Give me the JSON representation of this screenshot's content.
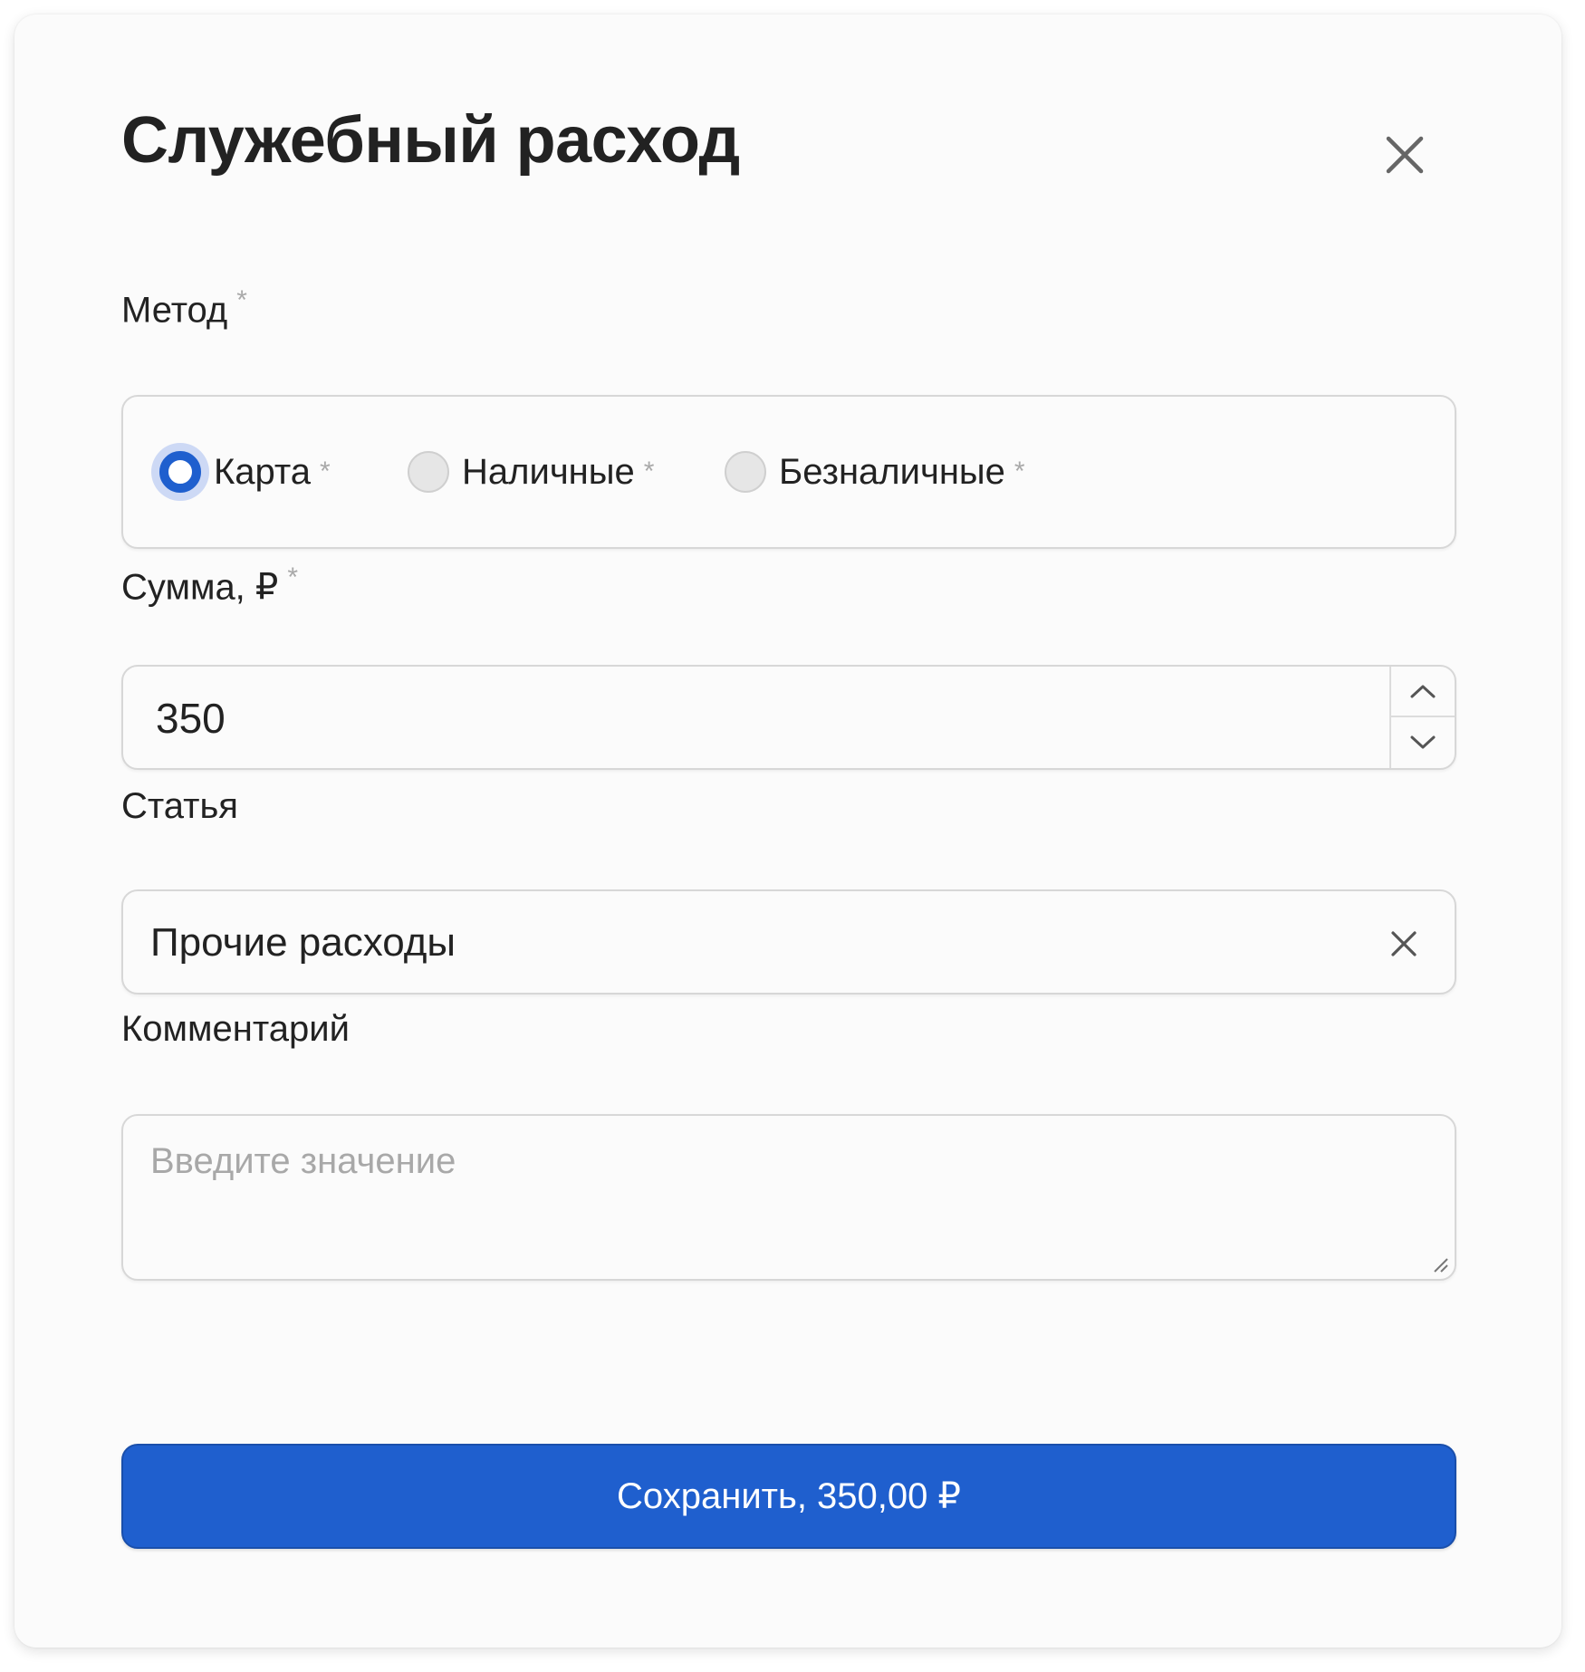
{
  "modal": {
    "title": "Служебный расход",
    "close_icon": "close-icon"
  },
  "method": {
    "label": "Метод",
    "required_mark": "*",
    "options": [
      {
        "label": "Карта",
        "required_mark": "*",
        "checked": true
      },
      {
        "label": "Наличные",
        "required_mark": "*",
        "checked": false
      },
      {
        "label": "Безналичные",
        "required_mark": "*",
        "checked": false
      }
    ]
  },
  "amount": {
    "label": "Сумма, ₽",
    "required_mark": "*",
    "value": "350",
    "increment_icon": "chevron-up-icon",
    "decrement_icon": "chevron-down-icon"
  },
  "article": {
    "label": "Статья",
    "value": "Прочие расходы",
    "clear_icon": "clear-icon"
  },
  "comment": {
    "label": "Комментарий",
    "placeholder": "Введите значение",
    "value": ""
  },
  "save_button": {
    "label": "Сохранить, 350,00 ₽"
  },
  "colors": {
    "accent": "#1f5fce",
    "radio_ring": "#cdd9f5",
    "required_mark": "#a9a9a9",
    "placeholder": "#a8a8a8",
    "border": "#d7d7d7"
  }
}
